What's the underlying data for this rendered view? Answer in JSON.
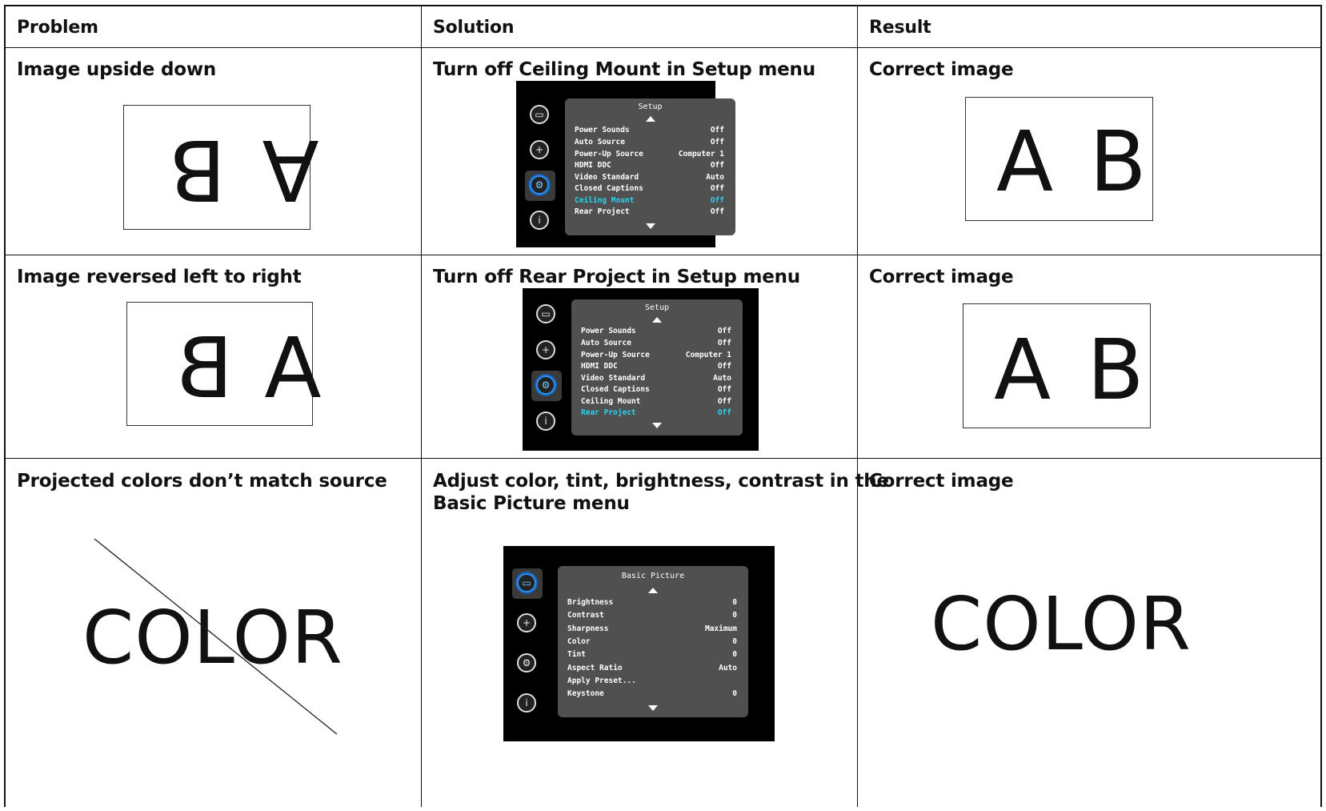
{
  "headers": {
    "problem": "Problem",
    "solution": "Solution",
    "result": "Result"
  },
  "rows": [
    {
      "problem": "Image upside down",
      "solution": "Turn off Ceiling Mount in Setup menu",
      "result": "Correct image",
      "problem_sample": "A B",
      "result_sample": "A B"
    },
    {
      "problem": "Image reversed left to right",
      "solution": "Turn off Rear Project in Setup menu",
      "result": "Correct image",
      "problem_sample_left": "B",
      "problem_sample_right": "A",
      "result_sample": "A B"
    },
    {
      "problem": "Projected colors don’t match source",
      "solution_line1": "Adjust color, tint, brightness, contrast in the",
      "solution_line2": "Basic Picture menu",
      "result": "Correct image",
      "problem_sample": "COLOR",
      "result_sample": "COLOR"
    }
  ],
  "menus": {
    "setup1": {
      "title": "Setup",
      "items": [
        {
          "label": "Power Sounds",
          "value": "Off"
        },
        {
          "label": "Auto Source",
          "value": "Off"
        },
        {
          "label": "Power-Up Source",
          "value": "Computer 1"
        },
        {
          "label": "HDMI DDC",
          "value": "Off"
        },
        {
          "label": "Video Standard",
          "value": "Auto"
        },
        {
          "label": "Closed Captions",
          "value": "Off"
        },
        {
          "label": "Ceiling Mount",
          "value": "Off"
        },
        {
          "label": "Rear Project",
          "value": "Off"
        }
      ]
    },
    "setup2": {
      "title": "Setup",
      "items": [
        {
          "label": "Power Sounds",
          "value": "Off"
        },
        {
          "label": "Auto Source",
          "value": "Off"
        },
        {
          "label": "Power-Up Source",
          "value": "Computer 1"
        },
        {
          "label": "HDMI DDC",
          "value": "Off"
        },
        {
          "label": "Video Standard",
          "value": "Auto"
        },
        {
          "label": "Closed Captions",
          "value": "Off"
        },
        {
          "label": "Ceiling Mount",
          "value": "Off"
        },
        {
          "label": "Rear Project",
          "value": "Off"
        }
      ]
    },
    "basic": {
      "title": "Basic Picture",
      "items": [
        {
          "label": "Brightness",
          "value": "0"
        },
        {
          "label": "Contrast",
          "value": "0"
        },
        {
          "label": "Sharpness",
          "value": "Maximum"
        },
        {
          "label": "Color",
          "value": "0"
        },
        {
          "label": "Tint",
          "value": "0"
        },
        {
          "label": "Aspect Ratio",
          "value": "Auto"
        },
        {
          "label": "Apply Preset...",
          "value": ""
        },
        {
          "label": "Keystone",
          "value": "0"
        }
      ]
    }
  },
  "colors": {
    "highlight": "#28d4f0",
    "menu_bg": "#505050",
    "active_ring": "#2a8ff0"
  },
  "icons": [
    "picture-icon",
    "advanced-picture-icon",
    "setup-gear-icon",
    "info-icon"
  ]
}
